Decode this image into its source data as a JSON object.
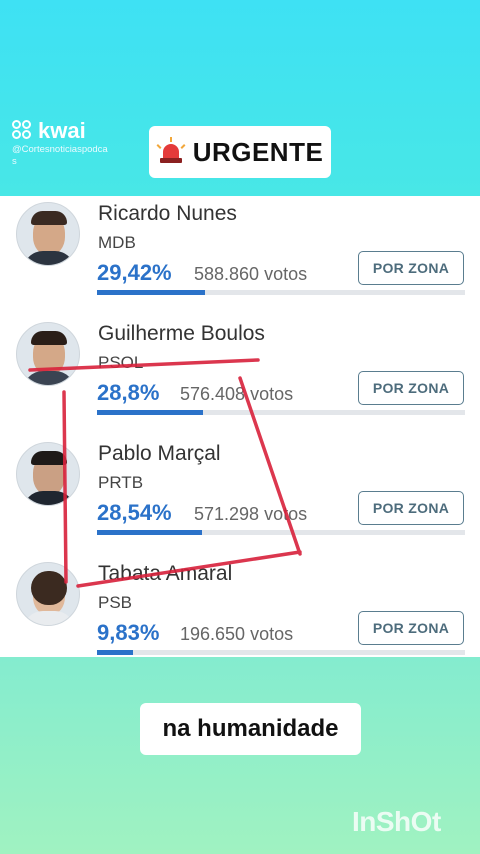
{
  "watermark": {
    "brand": "kwai",
    "handle": "@Cortesnoticiaspodcas",
    "editor": "InShOt"
  },
  "badge": {
    "icon": "siren-icon",
    "label": "URGENTE"
  },
  "candidates": [
    {
      "name": "Ricardo Nunes",
      "party": "MDB",
      "percent": "29,42%",
      "votes": "588.860 votos",
      "share": 0.2942,
      "button": "POR ZONA"
    },
    {
      "name": "Guilherme Boulos",
      "party": "PSOL",
      "percent": "28,8%",
      "votes": "576.408 votos",
      "share": 0.288,
      "button": "POR ZONA"
    },
    {
      "name": "Pablo Marçal",
      "party": "PRTB",
      "percent": "28,54%",
      "votes": "571.298 votos",
      "share": 0.2854,
      "button": "POR ZONA"
    },
    {
      "name": "Tabata Amaral",
      "party": "PSB",
      "percent": "9,83%",
      "votes": "196.650 votos",
      "share": 0.0983,
      "button": "POR ZONA"
    }
  ],
  "caption": "na humanidade",
  "colors": {
    "accent": "#2b72c9",
    "annotation": "#d8213b",
    "top_background": "#3ee1f4",
    "bottom_background": "#a0f2c1"
  }
}
